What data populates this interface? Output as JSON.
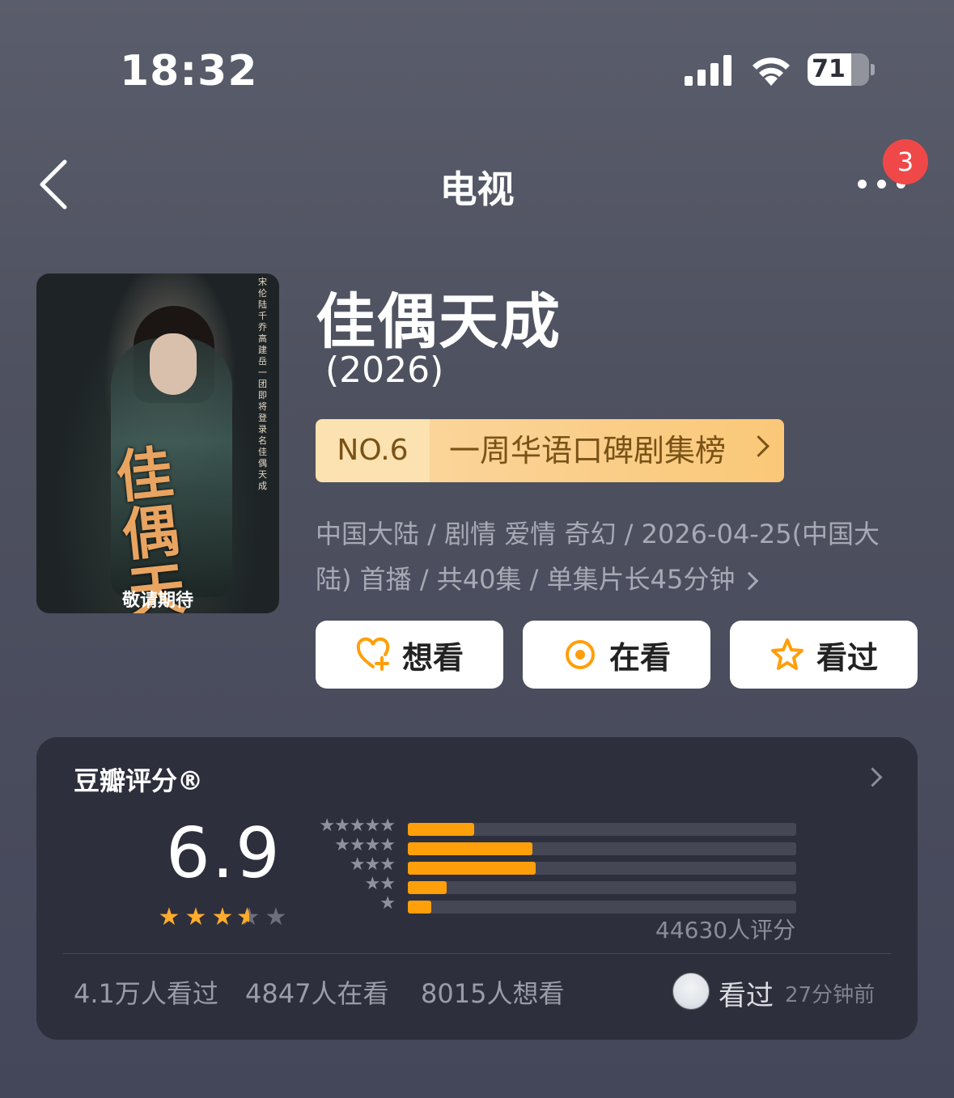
{
  "status_bar": {
    "time": "18:32",
    "battery": "71",
    "battery_level": 0.71
  },
  "nav": {
    "title": "电视",
    "badge": "3"
  },
  "poster": {
    "tagline": "敬请期待",
    "title_art": "佳偶天成",
    "credits": "宋伦 陆千乔 高建岳一团 即将登录名 佳偶天成"
  },
  "show": {
    "title": "佳偶天成",
    "year": "(2026)",
    "rank_no": "NO.6",
    "rank_label": "一周华语口碑剧集榜",
    "meta_line1": "中国大陆 / 剧情 爱情 奇幻 / 2026-04-25(中国大",
    "meta_line2": "陆) 首播 / 共40集 / 单集片长45分钟"
  },
  "actions": [
    {
      "label": "想看",
      "icon": "heart-plus-icon"
    },
    {
      "label": "在看",
      "icon": "circle-dot-icon"
    },
    {
      "label": "看过",
      "icon": "star-outline-icon"
    }
  ],
  "rating": {
    "title": "豆瓣评分®",
    "score": "6.9",
    "stars": 3.5,
    "distribution": [
      {
        "stars": "★★★★★",
        "percent": 17
      },
      {
        "stars": "★★★★",
        "percent": 32
      },
      {
        "stars": "★★★",
        "percent": 33
      },
      {
        "stars": "★★",
        "percent": 10
      },
      {
        "stars": "★",
        "percent": 6
      }
    ],
    "count": "44630人评分",
    "watched": "4.1万人看过",
    "watching": "4847人在看",
    "want": "8015人想看",
    "user_status": "看过",
    "user_time": "27分钟前"
  },
  "colors": {
    "accent": "#ff9f0a",
    "badge": "#f04848",
    "rank_bg": "#fac877",
    "card_bg": "#2e2f3c"
  }
}
